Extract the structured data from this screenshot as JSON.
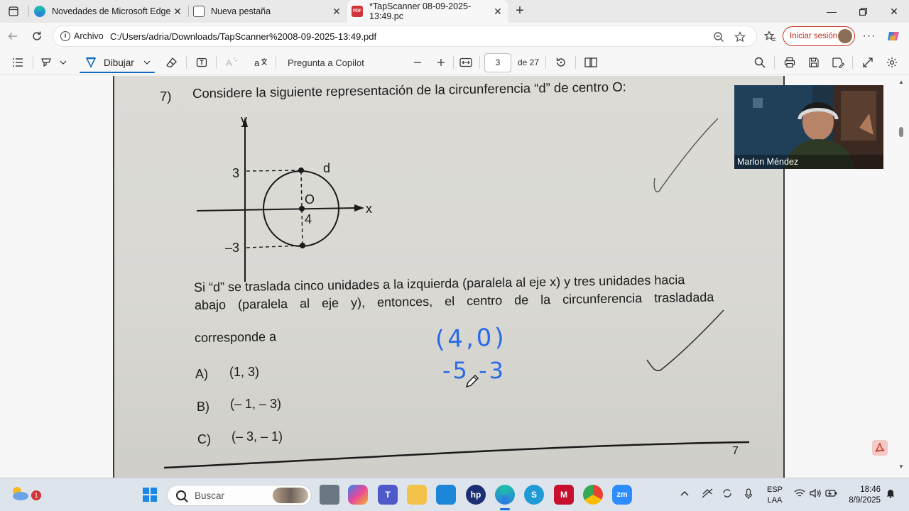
{
  "browser": {
    "tabs": [
      {
        "title": "Novedades de Microsoft Edge",
        "active": false
      },
      {
        "title": "Nueva pestaña",
        "active": false
      },
      {
        "title": "*TapScanner 08-09-2025-13:49.pc",
        "active": true
      }
    ],
    "address": {
      "site_label": "Archivo",
      "url": "C:/Users/adria/Downloads/TapScanner%2008-09-2025-13:49.pdf"
    },
    "signin_label": "Iniciar sesión"
  },
  "pdf_toolbar": {
    "draw_label": "Dibujar",
    "copilot_label": "Pregunta a Copilot",
    "current_page": "3",
    "page_total": "de 27"
  },
  "document": {
    "question_number": "7)",
    "question_text": "Considere la siguiente representación de la circunferencia “d” de centro O:",
    "graph_labels": {
      "y_axis": "y",
      "x_axis": "x",
      "tick_3": "3",
      "tick_neg3": "–3",
      "circle_name": "d",
      "center_name": "O",
      "center_x": "4"
    },
    "paragraph_lines": [
      "Si “d” se traslada cinco unidades a la izquierda (paralela al eje x) y tres unidades hacia",
      "abajo (paralela al eje y), entonces, el centro de la circunferencia trasladada",
      "corresponde a"
    ],
    "options": [
      {
        "letter": "A)",
        "value": "(1, 3)"
      },
      {
        "letter": "B)",
        "value": "(– 1, – 3)"
      },
      {
        "letter": "C)",
        "value": "(– 3, – 1)"
      }
    ],
    "page_number": "7",
    "handwriting": {
      "line1": "(4,0)",
      "line2": "-5 -3"
    }
  },
  "webcam": {
    "name": "Marlon Méndez"
  },
  "taskbar": {
    "search_placeholder": "Buscar",
    "weather_badge": "1",
    "language": "ESP",
    "language_sub": "LAA",
    "time": "18:46",
    "date": "8/9/2025"
  },
  "colors": {
    "ink_blue": "#2a6ae8",
    "accent": "#0f6cbd",
    "signin_red": "#c42b1c"
  }
}
